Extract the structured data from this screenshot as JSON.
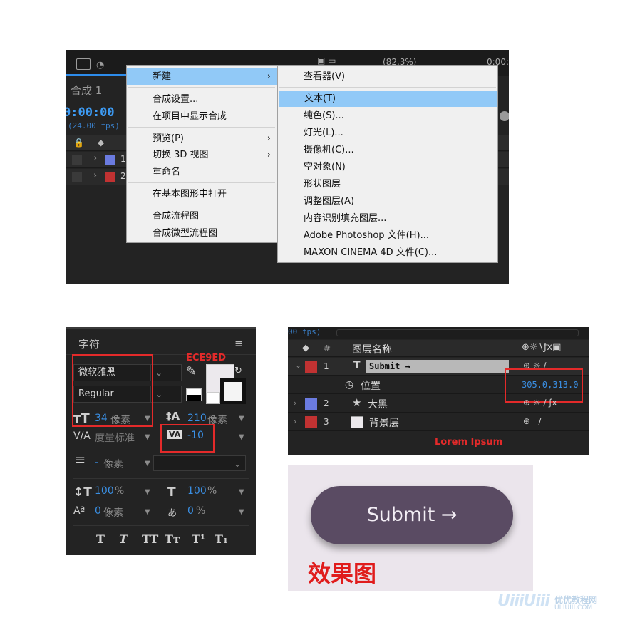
{
  "composition": {
    "comp_title": "合成 1",
    "timecode": "0:00:00",
    "fps": "(24.00 fps)",
    "zoom": "(82.3%)",
    "timecode_right": "0:00:",
    "layer_numbers": [
      "1",
      "2"
    ],
    "layer_colors": [
      "#6b7be0",
      "#c13232"
    ]
  },
  "context_menu": {
    "items": [
      {
        "label": "新建",
        "submenu": true,
        "highlighted": true
      },
      {
        "label": "合成设置..."
      },
      {
        "label": "在项目中显示合成"
      },
      {
        "label": "预览(P)",
        "submenu": true
      },
      {
        "label": "切换 3D 视图",
        "submenu": true
      },
      {
        "label": "重命名"
      },
      {
        "label": "在基本图形中打开"
      },
      {
        "label": "合成流程图"
      },
      {
        "label": "合成微型流程图"
      }
    ]
  },
  "submenu_new": {
    "items": [
      {
        "label": "查看器(V)"
      },
      {
        "label": "文本(T)",
        "highlighted": true
      },
      {
        "label": "纯色(S)..."
      },
      {
        "label": "灯光(L)..."
      },
      {
        "label": "摄像机(C)..."
      },
      {
        "label": "空对象(N)"
      },
      {
        "label": "形状图层"
      },
      {
        "label": "调整图层(A)"
      },
      {
        "label": "内容识别填充图层..."
      },
      {
        "label": "Adobe Photoshop 文件(H)..."
      },
      {
        "label": "MAXON CINEMA 4D 文件(C)..."
      }
    ]
  },
  "character_panel": {
    "title": "字符",
    "menu_icon": "≡",
    "font_family": "微软雅黑",
    "font_style": "Regular",
    "fill_color_label": "ECE9ED",
    "font_size_value": "34",
    "font_size_unit": "像素",
    "leading_value": "210",
    "leading_unit": "像素",
    "kerning_label": "度量标准",
    "tracking_value": "-10",
    "stroke_value": "-",
    "stroke_unit": "像素",
    "vscale_value": "100",
    "vscale_unit": "%",
    "hscale_value": "100",
    "hscale_unit": "%",
    "baseline_value": "0",
    "baseline_unit": "像素",
    "tsume_value": "0",
    "tsume_unit": "%",
    "style_buttons": [
      "T",
      "T",
      "TT",
      "Tт",
      "T¹",
      "T₁"
    ]
  },
  "layers_panel": {
    "fps_fragment": "00 fps)",
    "header": {
      "label_icon": "tag-icon",
      "num": "#",
      "name": "图层名称"
    },
    "rows": [
      {
        "num": "1",
        "name": "Submit →",
        "color": "#c13232",
        "type": "T"
      },
      {
        "sub": "位置",
        "value": "305.0,313.0"
      },
      {
        "num": "2",
        "name": "大黑",
        "color": "#6b7be0",
        "type": "★"
      },
      {
        "num": "3",
        "name": "背景层",
        "color": "#c13232",
        "type": "□"
      }
    ],
    "footer_text": "Lorem Ipsum"
  },
  "preview": {
    "button_label": "Submit →",
    "caption": "效果图"
  },
  "watermark": {
    "logo": "UiiiUiii",
    "cn": "优优教程网",
    "url": "UIIIUIII.COM"
  }
}
